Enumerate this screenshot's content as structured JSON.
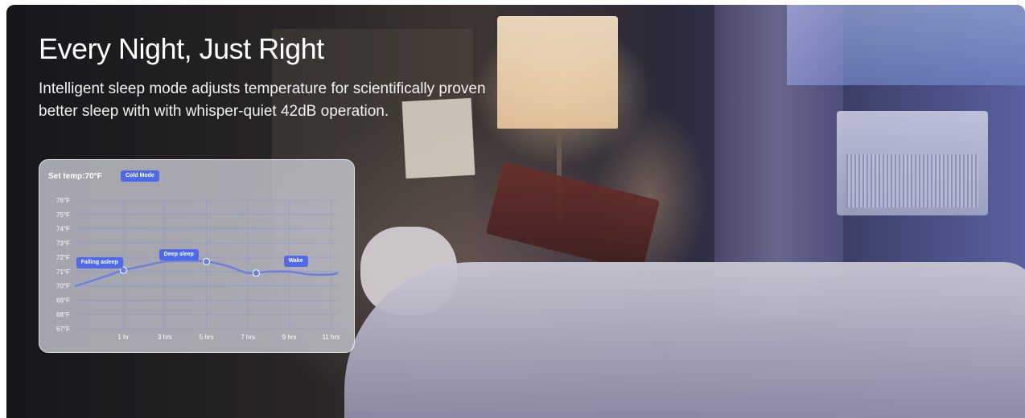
{
  "headline": "Every Night, Just Right",
  "subtitle": "Intelligent sleep mode adjusts temperature for scientifically proven better sleep with with whisper-quiet 42dB operation.",
  "chart_card": {
    "set_temp": "Set temp:70°F",
    "mode_chip": "Cold Mode"
  },
  "colors": {
    "accent": "#4f6ae6",
    "curve": "#6b7fe0"
  },
  "chart_data": {
    "type": "line",
    "ylim": [
      67,
      76
    ],
    "y_ticks": [
      "76°F",
      "75°F",
      "74°F",
      "73°F",
      "72°F",
      "71°F",
      "70°F",
      "69°F",
      "68°F",
      "67°F"
    ],
    "x_ticks": [
      "1 hr",
      "3 hrs",
      "5 hrs",
      "7 hrs",
      "9 hrs",
      "11 hrs"
    ],
    "x_tick_values": [
      1,
      3,
      5,
      7,
      9,
      11
    ],
    "xlim": [
      -1.3,
      11.3
    ],
    "series": [
      {
        "x": [
          -1.3,
          0,
          1,
          2,
          3,
          4,
          5,
          6,
          7,
          8,
          9,
          10,
          11,
          11.3
        ],
        "y": [
          70,
          70.6,
          71.1,
          71.4,
          71.7,
          71.75,
          71.7,
          71.4,
          70.9,
          71.0,
          71.0,
          70.8,
          70.8,
          70.9
        ],
        "markers": [
          {
            "x": 1,
            "y": 71.1
          },
          {
            "x": 5,
            "y": 71.7
          },
          {
            "x": 7.4,
            "y": 70.9
          }
        ]
      }
    ],
    "annotations": [
      {
        "label": "Falling asleep",
        "x": -0.5,
        "y": 71.6
      },
      {
        "label": "Deep sleep",
        "x": 3.5,
        "y": 72.2
      },
      {
        "label": "Wake",
        "x": 9.5,
        "y": 71.7
      }
    ]
  }
}
